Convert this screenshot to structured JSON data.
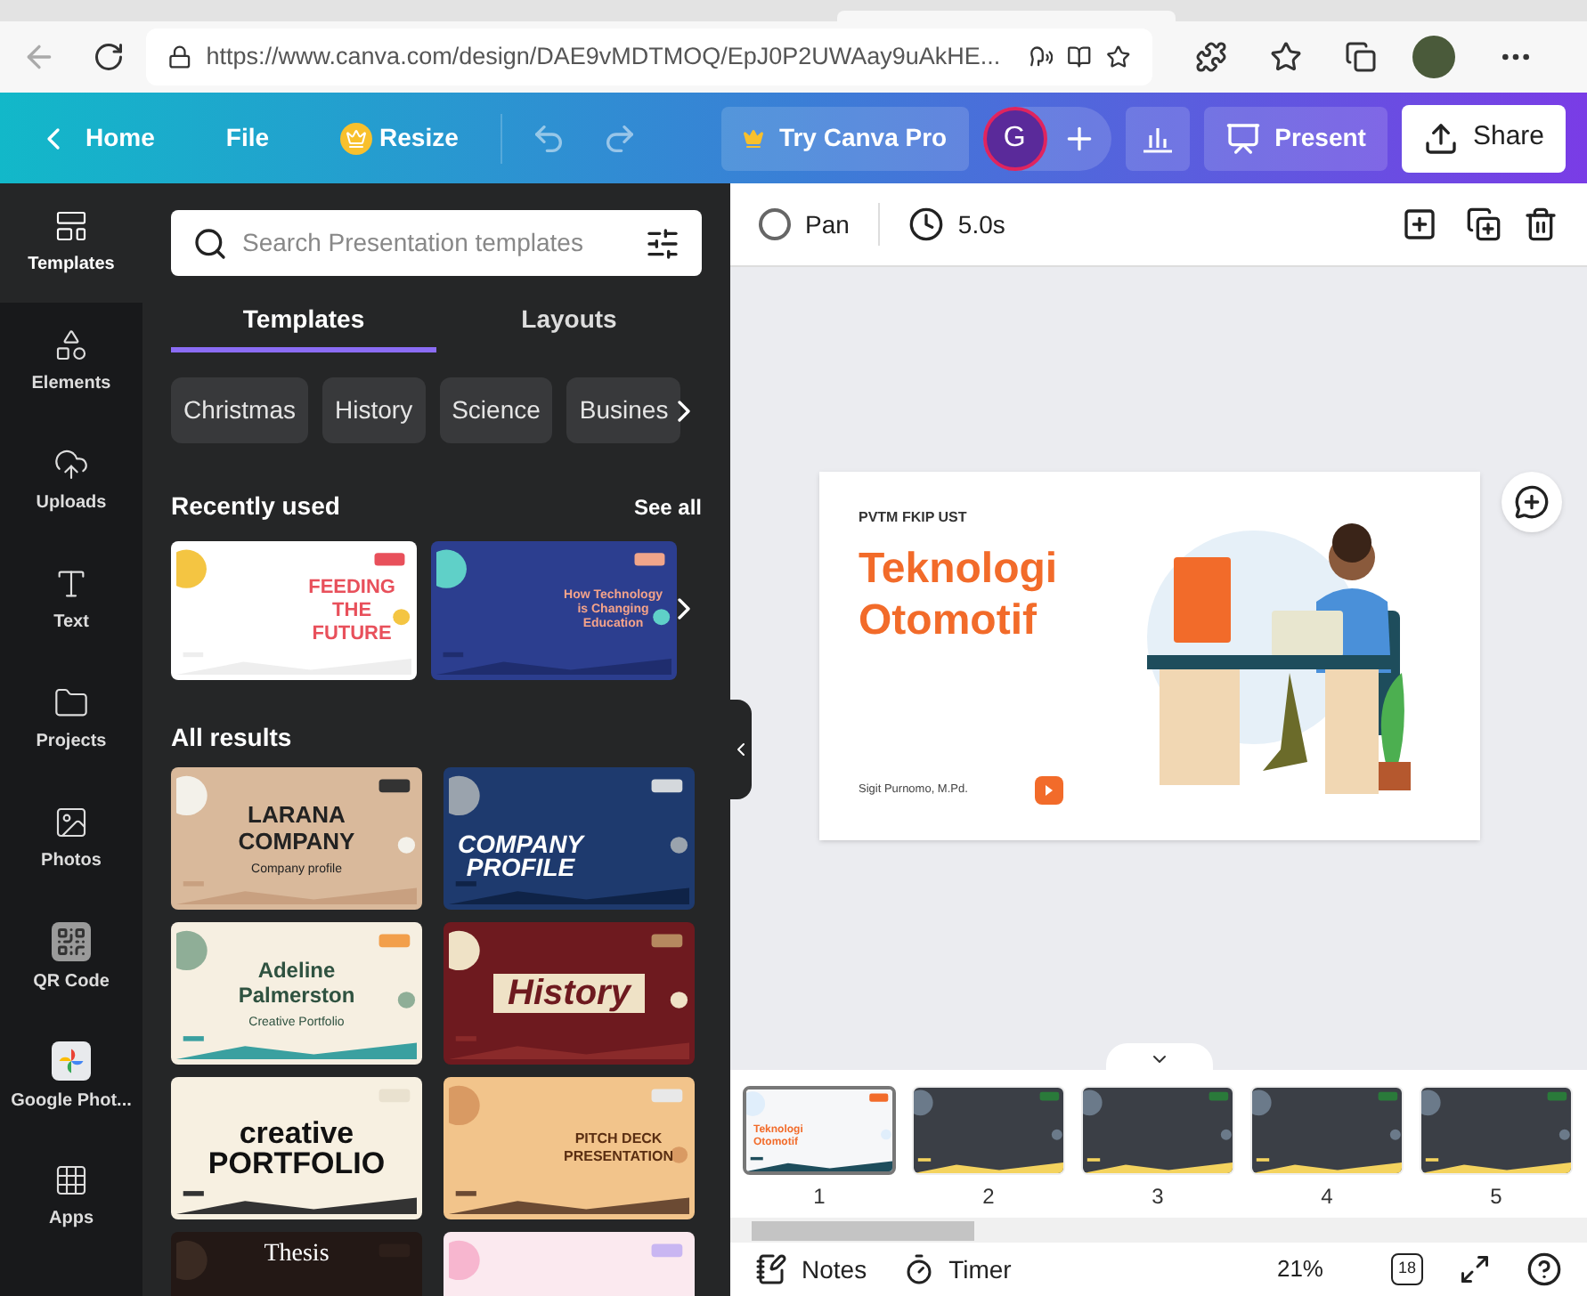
{
  "browser": {
    "url": "https://www.canva.com/design/DAE9vMDTMOQ/EpJ0P2UWAay9uAkHE..."
  },
  "header": {
    "home": "Home",
    "file": "File",
    "resize": "Resize",
    "try_pro": "Try Canva Pro",
    "avatar": "G",
    "present": "Present",
    "share": "Share"
  },
  "rail": [
    {
      "label": "Templates",
      "selected": true,
      "kind": "templates"
    },
    {
      "label": "Elements",
      "selected": false,
      "kind": "elements"
    },
    {
      "label": "Uploads",
      "selected": false,
      "kind": "uploads"
    },
    {
      "label": "Text",
      "selected": false,
      "kind": "text"
    },
    {
      "label": "Projects",
      "selected": false,
      "kind": "projects"
    },
    {
      "label": "Photos",
      "selected": false,
      "kind": "photos"
    },
    {
      "label": "QR Code",
      "selected": false,
      "kind": "qr"
    },
    {
      "label": "Google Phot...",
      "selected": false,
      "kind": "gphotos"
    },
    {
      "label": "Apps",
      "selected": false,
      "kind": "apps"
    }
  ],
  "panel": {
    "search": {
      "placeholder": "Search Presentation templates"
    },
    "tabs": [
      {
        "label": "Templates",
        "selected": true
      },
      {
        "label": "Layouts",
        "selected": false
      }
    ],
    "chips": [
      "Christmas",
      "History",
      "Science",
      "Busines"
    ],
    "recently_used": {
      "title": "Recently used",
      "see_all": "See all",
      "templates": [
        {
          "kind": "feeding",
          "lines": [
            "FEEDING",
            "THE",
            "FUTURE"
          ]
        },
        {
          "kind": "tech",
          "lines": [
            "How Technology",
            "is Changing",
            "Education"
          ]
        }
      ]
    },
    "all_results": {
      "title": "All results",
      "templates": [
        {
          "kind": "larana",
          "lines": [
            "LARANA",
            "COMPANY"
          ],
          "subtitle": "Company profile"
        },
        {
          "kind": "company",
          "lines": [
            "COMPANY",
            "PROFILE"
          ]
        },
        {
          "kind": "adeline",
          "lines": [
            "Adeline",
            "Palmerston"
          ],
          "subtitle": "Creative Portfolio"
        },
        {
          "kind": "history",
          "lines": [
            "History"
          ]
        },
        {
          "kind": "portfolio",
          "lines": [
            "creative",
            "PORTFOLIO"
          ]
        },
        {
          "kind": "pitch",
          "lines": [
            "PITCH DECK",
            "PRESENTATION"
          ]
        },
        {
          "kind": "thesis",
          "lines": [
            "Thesis"
          ]
        },
        {
          "kind": "pastel"
        }
      ]
    }
  },
  "editor": {
    "pan": "Pan",
    "duration": "5.0s",
    "slide": {
      "org": "PVTM FKIP UST",
      "title_lines": [
        "Teknologi",
        "Otomotif"
      ],
      "author": "Sigit Purnomo, M.Pd."
    },
    "thumbnails": [
      {
        "number": "1",
        "selected": true,
        "lines": [
          "Teknologi",
          "Otomotif"
        ]
      },
      {
        "number": "2",
        "selected": false
      },
      {
        "number": "3",
        "selected": false
      },
      {
        "number": "4",
        "selected": false
      },
      {
        "number": "5",
        "selected": false
      }
    ]
  },
  "footer": {
    "notes": "Notes",
    "timer": "Timer",
    "zoom": "21%",
    "pages": "18"
  }
}
